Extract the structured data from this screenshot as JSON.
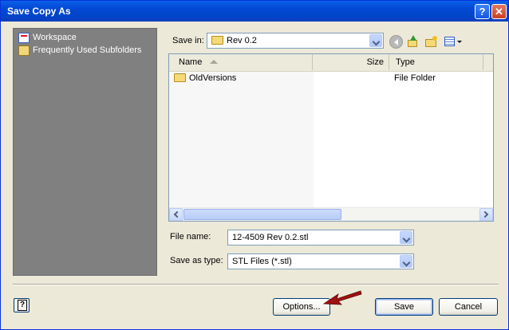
{
  "window": {
    "title": "Save Copy As",
    "help_glyph": "?",
    "close_glyph": "✕"
  },
  "places": {
    "items": [
      {
        "label": "Workspace",
        "icon": "workspace-icon"
      },
      {
        "label": "Frequently Used Subfolders",
        "icon": "subfolders-icon"
      }
    ]
  },
  "save_in": {
    "label": "Save in:",
    "value": "Rev 0.2"
  },
  "toolbar": {
    "icons": [
      "back-icon",
      "up-folder-icon",
      "new-folder-icon",
      "views-menu-icon"
    ]
  },
  "file_list": {
    "columns": [
      "Name",
      "Size",
      "Type"
    ],
    "rows": [
      {
        "name": "OldVersions",
        "size": "",
        "type": "File Folder"
      }
    ]
  },
  "file_name": {
    "label": "File name:",
    "value": "12-4509 Rev 0.2.stl"
  },
  "save_as_type": {
    "label": "Save as type:",
    "value": "STL Files (*.stl)"
  },
  "buttons": {
    "options": "Options...",
    "save": "Save",
    "cancel": "Cancel"
  },
  "colors": {
    "title_bar": "#0348d4",
    "places_panel": "#808080",
    "annotation_arrow": "#a01010"
  }
}
